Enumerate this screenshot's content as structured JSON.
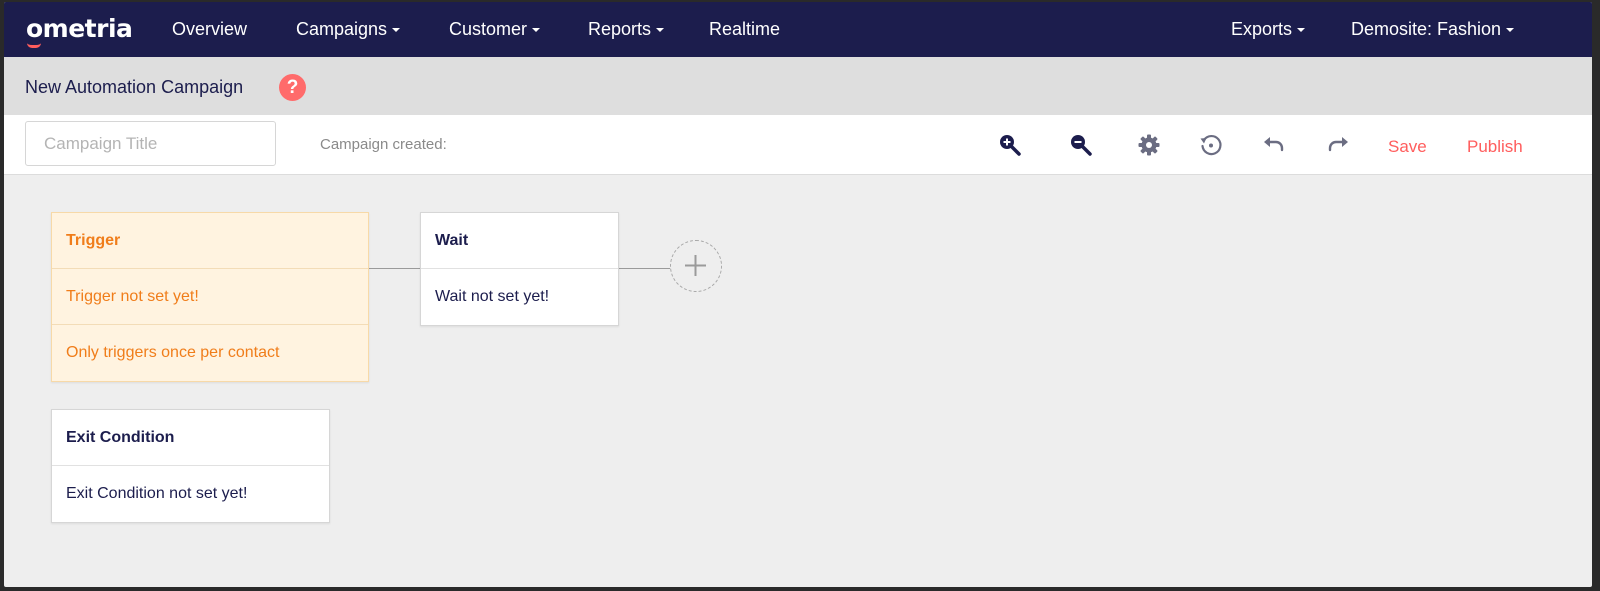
{
  "brand": {
    "logo_text": "ometria",
    "accent": "#ff5d5d",
    "nav_bg": "#1c1d4d"
  },
  "nav": {
    "overview": "Overview",
    "campaigns": "Campaigns",
    "customer": "Customer",
    "reports": "Reports",
    "realtime": "Realtime",
    "exports": "Exports",
    "site": "Demosite: Fashion"
  },
  "header": {
    "title": "New Automation Campaign",
    "help_glyph": "?"
  },
  "toolbar": {
    "title_placeholder": "Campaign Title",
    "title_value": "",
    "created_label": "Campaign created:",
    "icons": [
      "zoom-in-icon",
      "zoom-out-icon",
      "gear-icon",
      "history-icon",
      "undo-icon",
      "redo-icon"
    ],
    "save_label": "Save",
    "publish_label": "Publish"
  },
  "canvas": {
    "trigger": {
      "title": "Trigger",
      "status": "Trigger not set yet!",
      "frequency": "Only triggers once per contact"
    },
    "wait": {
      "title": "Wait",
      "status": "Wait not set yet!"
    },
    "exit": {
      "title": "Exit Condition",
      "status": "Exit Condition not set yet!"
    },
    "add_icon": "plus-icon"
  }
}
